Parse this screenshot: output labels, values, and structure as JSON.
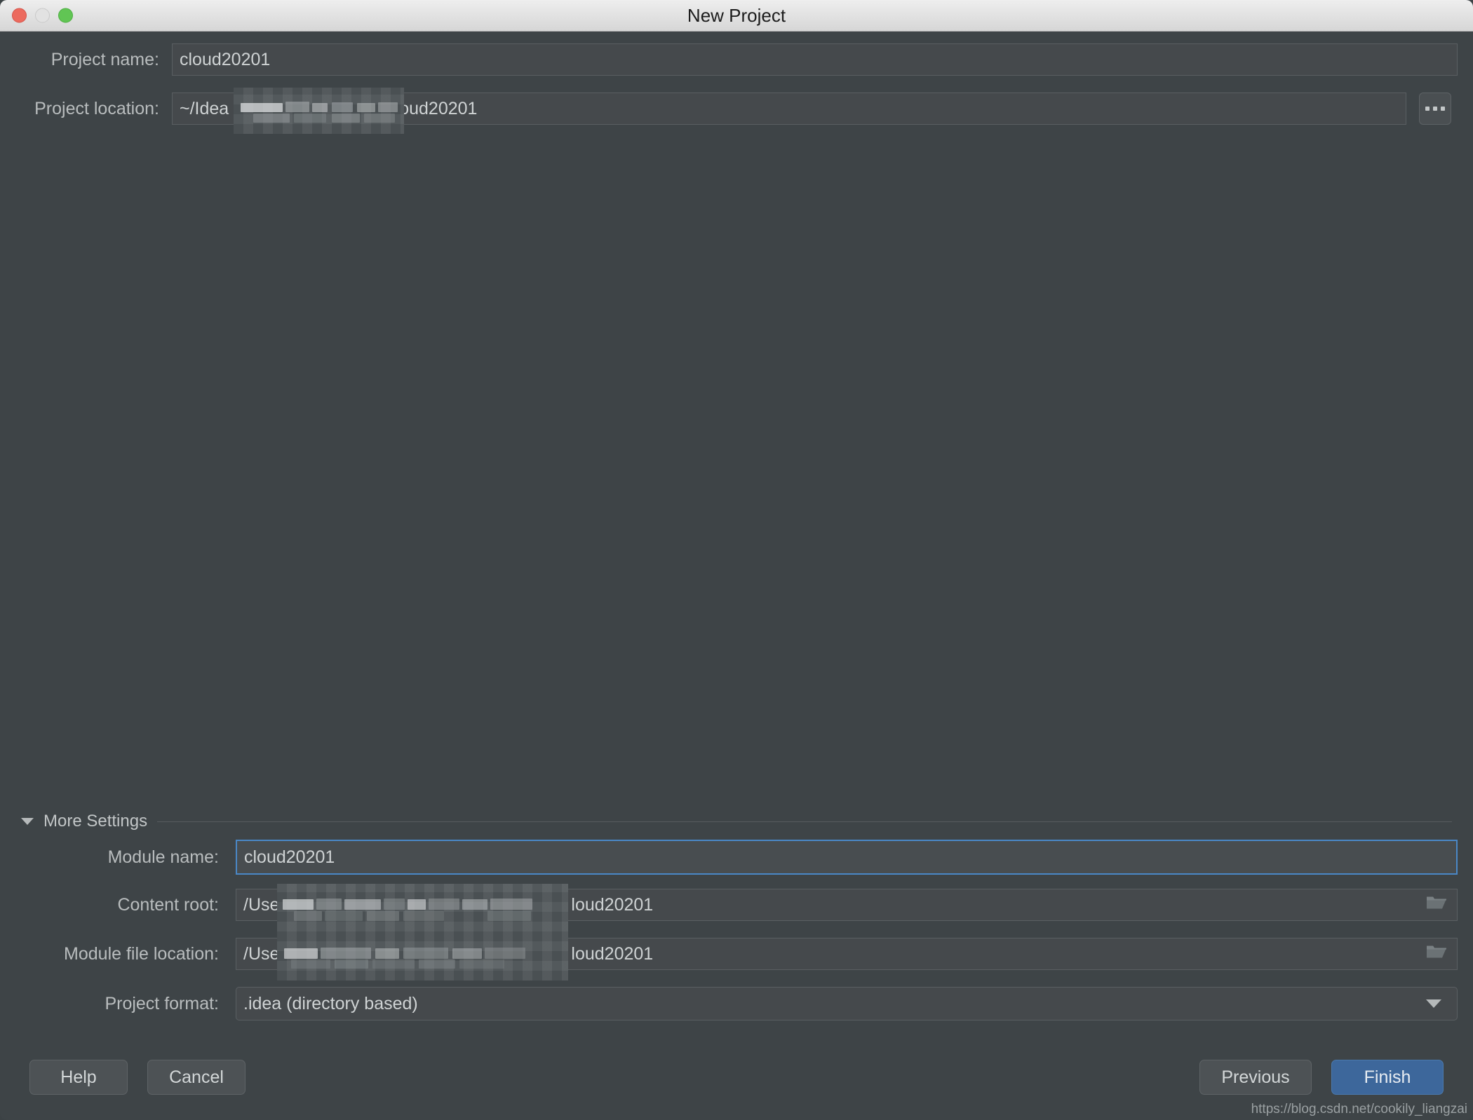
{
  "window": {
    "title": "New Project",
    "controls": {
      "close": "close-button",
      "minimize": "minimize-button",
      "maximize": "maximize-button"
    }
  },
  "form": {
    "project_name": {
      "label": "Project name:",
      "value": "cloud20201"
    },
    "project_location": {
      "label": "Project location:",
      "value_prefix": "~/Idea",
      "value_suffix": "oud20201",
      "browse_label": "..."
    }
  },
  "more_settings": {
    "label": "More Settings",
    "expanded": true,
    "module_name": {
      "label": "Module name:",
      "value": "cloud20201",
      "focused": true
    },
    "content_root": {
      "label": "Content root:",
      "value_prefix": "/Use",
      "value_suffix": "loud20201"
    },
    "module_file_location": {
      "label": "Module file location:",
      "value_prefix": "/Use",
      "value_suffix": "loud20201"
    },
    "project_format": {
      "label": "Project format:",
      "value": ".idea (directory based)"
    }
  },
  "buttons": {
    "help": "Help",
    "cancel": "Cancel",
    "previous": "Previous",
    "finish": "Finish"
  },
  "watermark": "https://blog.csdn.net/cookily_liangzai",
  "colors": {
    "dialog_bg": "#3e4447",
    "field_bg": "#45494c",
    "field_border": "#5a5f62",
    "focus_border": "#4a88c7",
    "primary_button": "#3d679b",
    "text": "#cfd3d4",
    "label_text": "#b9bdbe",
    "titlebar_text": "#1c1c1c",
    "close": "#ec6a5e",
    "minimize": "#e2e2e2",
    "maximize": "#61c554"
  }
}
